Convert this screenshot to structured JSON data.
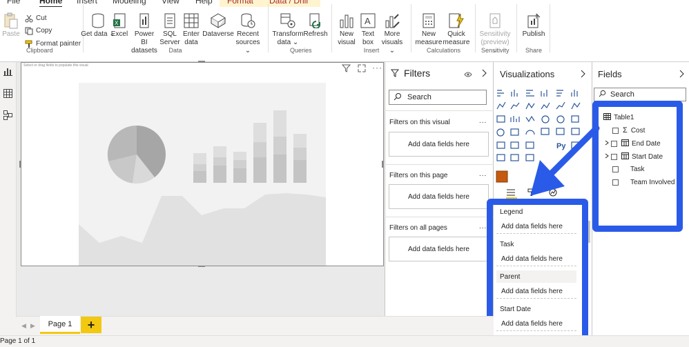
{
  "menu": {
    "tabs": [
      "File",
      "Home",
      "Insert",
      "Modeling",
      "View",
      "Help",
      "Format",
      "Data / Drill"
    ],
    "active": "Home"
  },
  "ribbon": {
    "clipboard": {
      "paste": "Paste",
      "cut": "Cut",
      "copy": "Copy",
      "format_painter": "Format painter",
      "label": "Clipboard"
    },
    "data": {
      "get_data": "Get data",
      "excel": "Excel",
      "pbi_datasets": "Power BI datasets",
      "sql_server": "SQL Server",
      "enter_data": "Enter data",
      "dataverse": "Dataverse",
      "recent_sources": "Recent sources",
      "label": "Data"
    },
    "queries": {
      "transform_data": "Transform data",
      "refresh": "Refresh",
      "label": "Queries"
    },
    "insert": {
      "new_visual": "New visual",
      "text_box": "Text box",
      "more_visuals": "More visuals",
      "label": "Insert"
    },
    "calculations": {
      "new_measure": "New measure",
      "quick_measure": "Quick measure",
      "label": "Calculations"
    },
    "sensitivity": {
      "sensitivity": "Sensitivity (preview)",
      "label": "Sensitivity"
    },
    "share": {
      "publish": "Publish",
      "label": "Share"
    },
    "chevron": "⌄"
  },
  "canvas": {
    "hint": "Select or drag fields to populate this visual"
  },
  "filters": {
    "title": "Filters",
    "search_placeholder": "Search",
    "sections": [
      {
        "title": "Filters on this visual",
        "well": "Add data fields here"
      },
      {
        "title": "Filters on this page",
        "well": "Add data fields here"
      },
      {
        "title": "Filters on all pages",
        "well": "Add data fields here"
      }
    ],
    "more": "..."
  },
  "visualizations": {
    "title": "Visualizations",
    "py_label": "Py",
    "wells": [
      {
        "label": "Legend",
        "placeholder": "Add data fields here"
      },
      {
        "label": "Task",
        "placeholder": "Add data fields here"
      },
      {
        "label": "Parent",
        "placeholder": "Add data fields here"
      },
      {
        "label": "Start Date",
        "placeholder": "Add data fields here"
      }
    ]
  },
  "fields": {
    "title": "Fields",
    "search_placeholder": "Search",
    "table": "Table1",
    "items": [
      {
        "name": "Cost",
        "icon": "sigma"
      },
      {
        "name": "End Date",
        "icon": "calendar"
      },
      {
        "name": "Start Date",
        "icon": "calendar"
      },
      {
        "name": "Task",
        "icon": "none"
      },
      {
        "name": "Team Involved",
        "icon": "none"
      }
    ]
  },
  "pages": {
    "tab": "Page 1",
    "add": "+",
    "status": "Page 1 of 1"
  },
  "colors": {
    "accent_yellow": "#f2c811",
    "annotation_blue": "#2a5be8",
    "ribbon_bg": "#ffffff"
  }
}
